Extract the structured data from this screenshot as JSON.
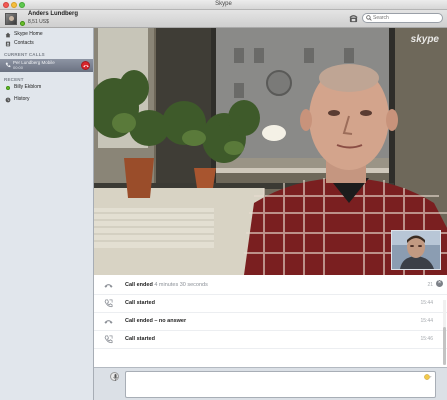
{
  "window": {
    "title": "Skype"
  },
  "toolbar": {
    "user_name": "Anders Lundberg",
    "credit": "8,51 US$",
    "status": "online",
    "search_placeholder": "Search"
  },
  "sidebar": {
    "nav": [
      {
        "label": "Skype Home",
        "icon": "home-icon"
      },
      {
        "label": "Contacts",
        "icon": "contacts-icon"
      }
    ],
    "current_calls_header": "CURRENT CALLS",
    "current_call": {
      "name": "Per Lundberg Mobile",
      "sub": "00:00"
    },
    "recent_header": "RECENT",
    "recent": [
      {
        "label": "Billy Ekblom",
        "status": "online"
      }
    ],
    "history_label": "History"
  },
  "video": {
    "logo_text": "skype"
  },
  "history": [
    {
      "title": "Call ended",
      "duration": "4 minutes 30 seconds",
      "time": "21",
      "icon": "call-ended-icon"
    },
    {
      "title": "Call started",
      "duration": "",
      "time": "15:44",
      "icon": "call-started-icon"
    },
    {
      "title": "Call ended – no answer",
      "duration": "",
      "time": "15:44",
      "icon": "call-ended-icon"
    },
    {
      "title": "Call started",
      "duration": "",
      "time": "15:46",
      "icon": "call-started-icon"
    }
  ],
  "composer": {
    "placeholder": ""
  },
  "colors": {
    "accent_blue": "#00aff0",
    "online_green": "#6bbf2b",
    "hangup_red": "#d9262c"
  }
}
